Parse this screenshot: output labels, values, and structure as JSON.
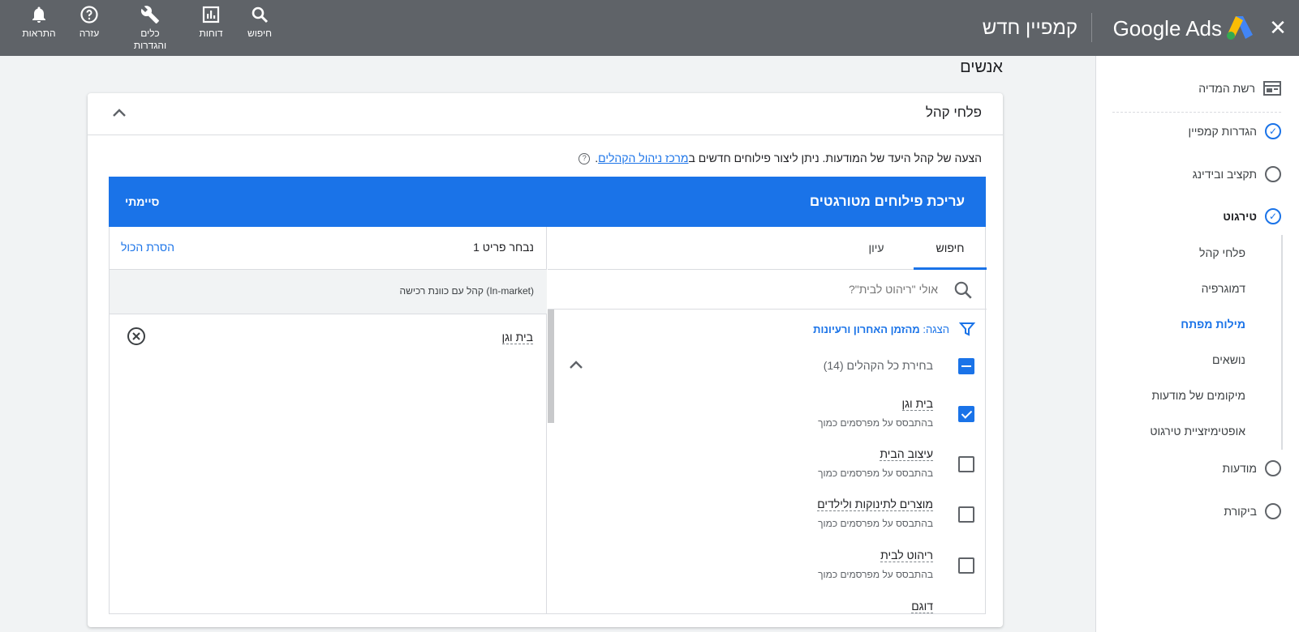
{
  "topbar": {
    "brand": "Google Ads",
    "campaign_title": "קמפיין חדש",
    "tools": {
      "search": "חיפוש",
      "reports": "דוחות",
      "tools_settings_1": "כלים",
      "tools_settings_2": "והגדרות",
      "help": "עזרה",
      "notifications": "התראות"
    }
  },
  "sidebar": {
    "network": "רשת המדיה",
    "steps": [
      {
        "label": "הגדרות קמפיין",
        "state": "done"
      },
      {
        "label": "תקציב ובידינג",
        "state": "todo"
      },
      {
        "label": "טירגוט",
        "state": "done"
      }
    ],
    "sub_items": [
      "פלחי קהל",
      "דמוגרפיה",
      "מילות מפתח",
      "נושאים",
      "מיקומים של מודעות",
      "אופטימיזציית טירגוט"
    ],
    "active_sub": "מילות מפתח",
    "after": [
      {
        "label": "מודעות",
        "state": "todo"
      },
      {
        "label": "ביקורת",
        "state": "todo"
      }
    ]
  },
  "main": {
    "section_title": "אנשים",
    "card_title": "פלחי קהל",
    "desc_text": "הצעה של קהל היעד של המודעות.  ניתן ליצור פילוחים חדשים ב",
    "desc_link": "מרכז ניהול הקהלים",
    "desc_end": ".",
    "edit_bar_title": "עריכת פילוחים מטורגטים",
    "done_label": "סיימתי",
    "selected": {
      "count": "נבחר פריט 1",
      "clear": "הסרת הכול",
      "category": "קהל עם כוונת רכישה (In-market)",
      "item": "בית וגן"
    },
    "tabs": {
      "search": "חיפוש",
      "browse": "עיון"
    },
    "search_placeholder": "אולי \"ריהוט לבית\"?",
    "filter_label": "הצגה:",
    "filter_value": "מהזמן האחרון ורעיונות",
    "select_all": "בחירת כל הקהלים (14)",
    "items": [
      {
        "name": "בית וגן",
        "sub": "בהתבסס על מפרסמים כמוך",
        "checked": true
      },
      {
        "name": "עיצוב הבית",
        "sub": "בהתבסס על מפרסמים כמוך",
        "checked": false
      },
      {
        "name": "מוצרים לתינוקות ולילדים",
        "sub": "בהתבסס על מפרסמים כמוך",
        "checked": false
      },
      {
        "name": "ריהוט לבית",
        "sub": "בהתבסס על מפרסמים כמוך",
        "checked": false
      },
      {
        "name": "דוגם",
        "sub": "",
        "checked": false
      }
    ]
  },
  "colors": {
    "topbar": "#5f6368",
    "accent": "#1a73e8",
    "page_bg": "#f1f3f4"
  }
}
